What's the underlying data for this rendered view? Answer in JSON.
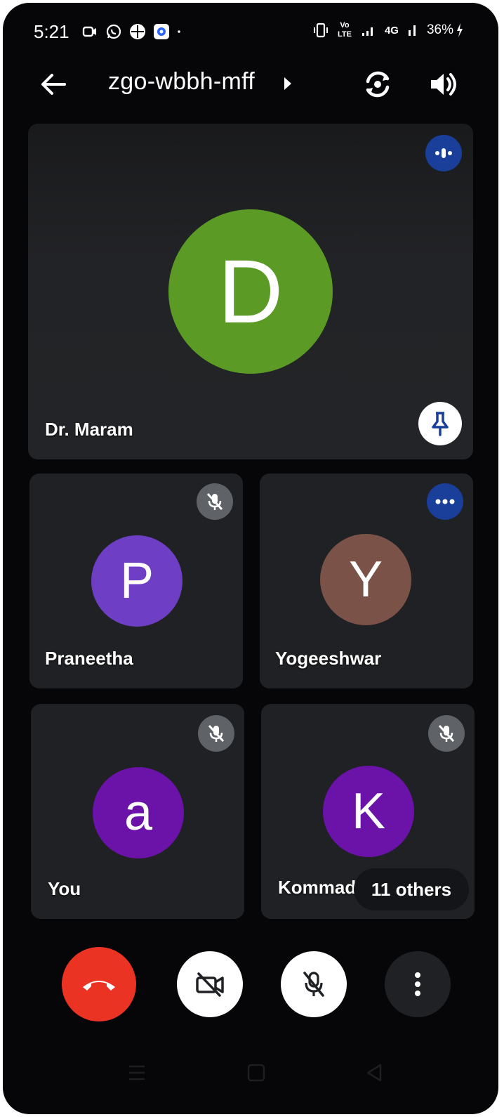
{
  "status_bar": {
    "time": "5:21",
    "battery": "36%",
    "network": "4G",
    "volte": "Vo LTE"
  },
  "header": {
    "meeting_code": "zgo-wbbh-mff"
  },
  "tiles": {
    "featured": {
      "name": "Dr. Maram",
      "initial": "D",
      "color": "#5a9a25"
    },
    "praneetha": {
      "name": "Praneetha",
      "initial": "P",
      "color": "#6e3fc4",
      "muted": true
    },
    "yogeeshwar": {
      "name": "Yogeeshwar",
      "initial": "Y",
      "color": "#7a5248"
    },
    "you": {
      "name": "You",
      "initial": "a",
      "color": "#6b12a8",
      "muted": true
    },
    "kommadi": {
      "name": "Kommadi",
      "initial": "K",
      "color": "#6b12a8",
      "muted": true
    }
  },
  "others_label": "11 others",
  "colors": {
    "end_call": "#ea3323",
    "active_badge": "#1a3f9a",
    "tile_bg": "#202124"
  }
}
